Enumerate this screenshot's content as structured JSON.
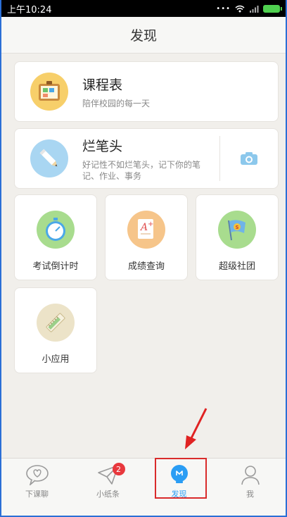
{
  "status_bar": {
    "time": "上午10:24",
    "dots": "•••"
  },
  "title": "发现",
  "cards": {
    "schedule": {
      "title": "课程表",
      "subtitle": "陪伴校园的每一天"
    },
    "pencil": {
      "title": "烂笔头",
      "subtitle_line1": "好记性不如烂笔头，记下你的笔",
      "subtitle_line2": "记、作业、事务"
    }
  },
  "tiles": [
    {
      "label": "考试倒计时",
      "icon": "stopwatch-icon",
      "color": "#a8dc8e"
    },
    {
      "label": "成绩查询",
      "icon": "grade-paper-icon",
      "color": "#f6c58a"
    },
    {
      "label": "超级社团",
      "icon": "flag-icon",
      "color": "#a8dc8e"
    },
    {
      "label": "小应用",
      "icon": "ruler-icon",
      "color": "#ece3c8"
    }
  ],
  "tabbar": [
    {
      "label": "下课聊",
      "icon": "chat-heart-icon"
    },
    {
      "label": "小纸条",
      "icon": "paper-plane-icon",
      "badge": "2"
    },
    {
      "label": "发现",
      "icon": "lightbulb-icon"
    },
    {
      "label": "我",
      "icon": "person-icon"
    }
  ],
  "colors": {
    "accent": "#2a9df4",
    "badge": "#e8383d",
    "highlight": "#d92b2b",
    "arrow": "#e02222"
  }
}
